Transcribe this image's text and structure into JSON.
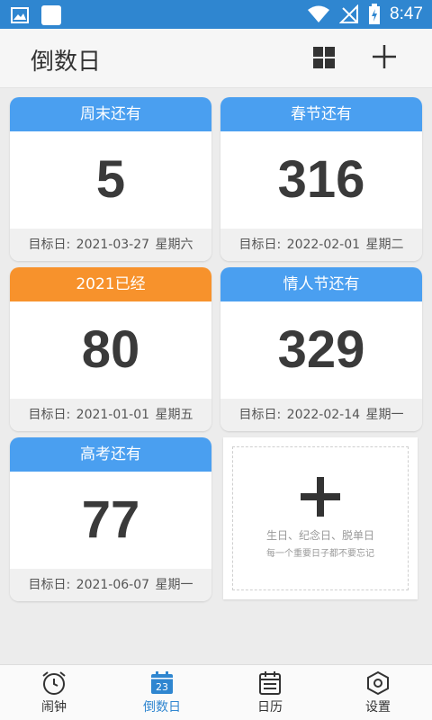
{
  "status_bar": {
    "time": "8:47"
  },
  "header": {
    "title": "倒数日"
  },
  "cards": [
    {
      "title": "周末还有",
      "days": "5",
      "target_label": "目标日:",
      "date": "2021-03-27",
      "weekday": "星期六",
      "color": "#4a9ff0"
    },
    {
      "title": "春节还有",
      "days": "316",
      "target_label": "目标日:",
      "date": "2022-02-01",
      "weekday": "星期二",
      "color": "#4a9ff0"
    },
    {
      "title": "2021已经",
      "days": "80",
      "target_label": "目标日:",
      "date": "2021-01-01",
      "weekday": "星期五",
      "color": "#f7922c"
    },
    {
      "title": "情人节还有",
      "days": "329",
      "target_label": "目标日:",
      "date": "2022-02-14",
      "weekday": "星期一",
      "color": "#4a9ff0"
    },
    {
      "title": "高考还有",
      "days": "77",
      "target_label": "目标日:",
      "date": "2021-06-07",
      "weekday": "星期一",
      "color": "#4a9ff0"
    }
  ],
  "add_card": {
    "line1": "生日、纪念日、脱单日",
    "line2": "每一个重要日子都不要忘记"
  },
  "tabs": [
    {
      "label": "闹钟"
    },
    {
      "label": "倒数日",
      "icon_text": "23"
    },
    {
      "label": "日历"
    },
    {
      "label": "设置"
    }
  ],
  "colors": {
    "accent": "#2f86d0",
    "blue_header": "#4a9ff0",
    "orange_header": "#f7922c"
  }
}
